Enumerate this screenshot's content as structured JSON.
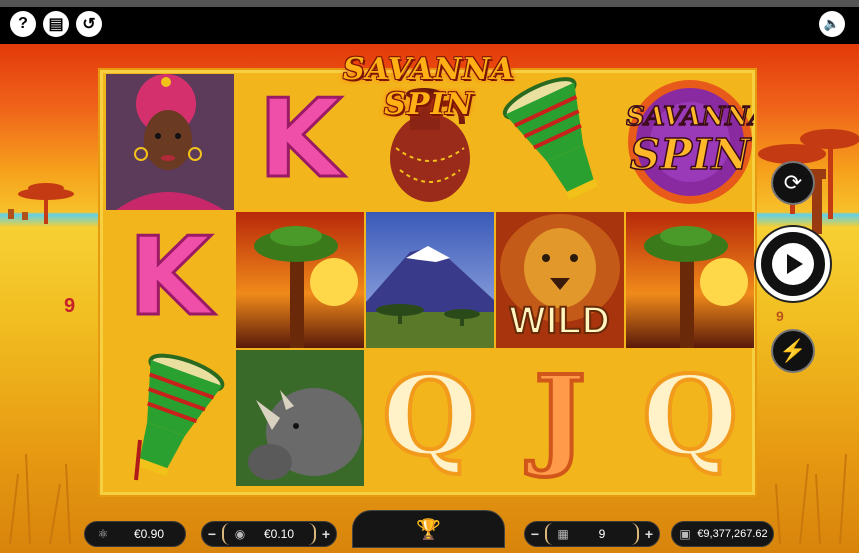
{
  "toolbar": {
    "help_icon": "question-icon",
    "help_glyph": "?",
    "paytable_icon": "book-icon",
    "paytable_glyph": "▤",
    "history_icon": "clock-history-icon",
    "history_glyph": "↺",
    "sound_icon": "speaker-icon",
    "sound_glyph": "🔈"
  },
  "game": {
    "title": "SAVANNA SPIN",
    "left_line_number": "9",
    "right_line_number": "9",
    "reels": [
      [
        "woman",
        "K",
        "drum"
      ],
      [
        "K",
        "baobab",
        "rhino"
      ],
      [
        "jug",
        "kilimanjaro",
        "Q"
      ],
      [
        "drum",
        "lion-wild",
        "J"
      ],
      [
        "logo",
        "baobab",
        "Q"
      ]
    ],
    "wild_label": "WILD",
    "logo_line1": "SAVANNA",
    "logo_line2": "SPIN",
    "k_letter": "K",
    "q_letter": "Q",
    "j_letter": "J"
  },
  "controls": {
    "autoplay_glyph": "⟳",
    "turbo_glyph": "⚡"
  },
  "bottom": {
    "win_value": "€0.90",
    "bet_value": "€0.10",
    "lines_value": "9",
    "balance_value": "€9,377,267.62",
    "minus": "−",
    "plus": "+",
    "trophy_glyph": "🏆",
    "win_glyph": "⚛",
    "coin_glyph": "◉",
    "lines_glyph": "▦",
    "wallet_glyph": "▣"
  },
  "colors": {
    "reel_bg": "#f3b51c",
    "sky_top": "#e23a0a",
    "title": "#ffb014"
  }
}
